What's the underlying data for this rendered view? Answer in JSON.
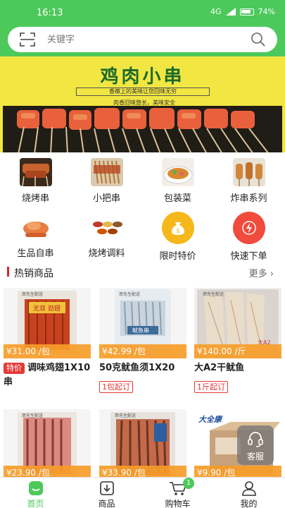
{
  "status_bar": {
    "time": "16:13",
    "signal": "4G",
    "battery": "74%"
  },
  "search": {
    "placeholder": "关键字"
  },
  "banner": {
    "title": "鸡肉小串",
    "line1": "香嫩上的美味让您回味无穷",
    "line2": "肉香回味悠长，美味安全"
  },
  "categories": [
    {
      "label": "烧烤串",
      "icon": "skewer-photo-icon"
    },
    {
      "label": "小把串",
      "icon": "small-skewer-photo-icon"
    },
    {
      "label": "包装菜",
      "icon": "packaged-dish-photo-icon"
    },
    {
      "label": "炸串系列",
      "icon": "fried-skewer-photo-icon"
    },
    {
      "label": "生品自串",
      "icon": "raw-meat-photo-icon"
    },
    {
      "label": "烧烤调料",
      "icon": "seasoning-photo-icon"
    },
    {
      "label": "限时特价",
      "icon": "money-bag-icon"
    },
    {
      "label": "快速下单",
      "icon": "lightning-icon"
    }
  ],
  "hot_section": {
    "title": "热销商品",
    "more": "更多"
  },
  "products": [
    {
      "price": "¥31.00 /包",
      "tag": "特价",
      "name": "调味鸡翅1X10串",
      "min_order": "",
      "img_text": "无双 劲翅"
    },
    {
      "price": "¥42.99 /包",
      "tag": "",
      "name": "50克鱿鱼须1X20",
      "min_order": "1包起订",
      "img_text": "鱿鱼串"
    },
    {
      "price": "¥140.00 /斤",
      "tag": "",
      "name": "大A2干鱿鱼",
      "min_order": "1斤起订",
      "img_text": "大A2"
    },
    {
      "price": "¥23.90 /包",
      "tag": "",
      "name": "",
      "min_order": "",
      "img_text": ""
    },
    {
      "price": "¥33.90 /包",
      "tag": "",
      "name": "",
      "min_order": "",
      "img_text": ""
    },
    {
      "price": "¥9.90 /包",
      "tag": "",
      "name": "",
      "min_order": "",
      "img_text": "大全康"
    }
  ],
  "product_label_badge": "串先生配送",
  "kefu": {
    "label": "客服"
  },
  "tabs": [
    {
      "label": "首页",
      "active": true
    },
    {
      "label": "商品",
      "active": false
    },
    {
      "label": "购物车",
      "active": false,
      "badge": "1"
    },
    {
      "label": "我的",
      "active": false
    }
  ],
  "colors": {
    "brand_green": "#4cc95a",
    "price_orange": "#f69c28",
    "accent_red": "#e53935"
  }
}
